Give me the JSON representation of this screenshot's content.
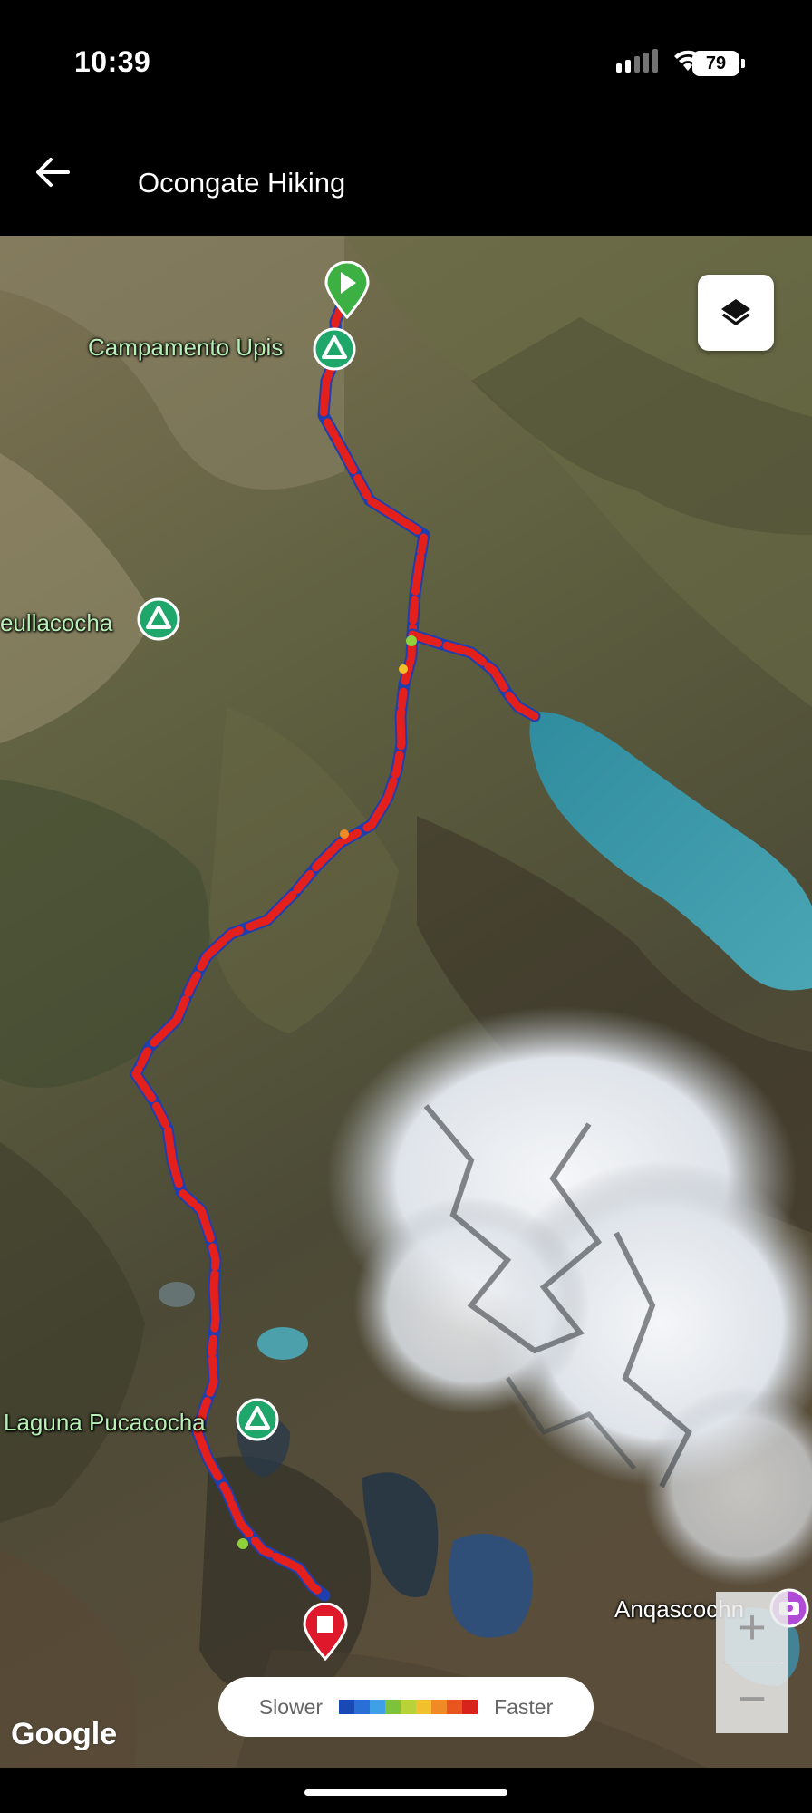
{
  "status_bar": {
    "time": "10:39",
    "battery": "79",
    "icons": [
      "signal-icon",
      "wifi-icon",
      "battery-icon"
    ]
  },
  "header": {
    "title": "Ocongate Hiking",
    "back_icon": "arrow-left-icon"
  },
  "map": {
    "places": {
      "upis": "Campamento Upis",
      "sibinacocha": "eullacocha",
      "pucacocha": "Laguna Pucacocha",
      "anqascocha": "Anqascochn"
    },
    "markers": [
      "start-marker",
      "finish-marker",
      "camp-marker",
      "camp-marker",
      "camp-marker",
      "photo-marker"
    ],
    "layers_icon": "layers-icon",
    "attribution": "Google",
    "colors": {
      "track_red": "#e3201b",
      "track_blue": "#1f4fc4",
      "start": "#3cb043",
      "finish": "#e0182b",
      "camp": "#1fa66b"
    }
  },
  "zoom": {
    "in_label": "+",
    "out_label": "−"
  },
  "legend": {
    "slower": "Slower",
    "faster": "Faster",
    "colors": [
      "#1849b5",
      "#2a6fd6",
      "#3fa0e8",
      "#7cc23a",
      "#b9d23a",
      "#f2c02c",
      "#f08a24",
      "#e8551f",
      "#d8231c"
    ]
  }
}
